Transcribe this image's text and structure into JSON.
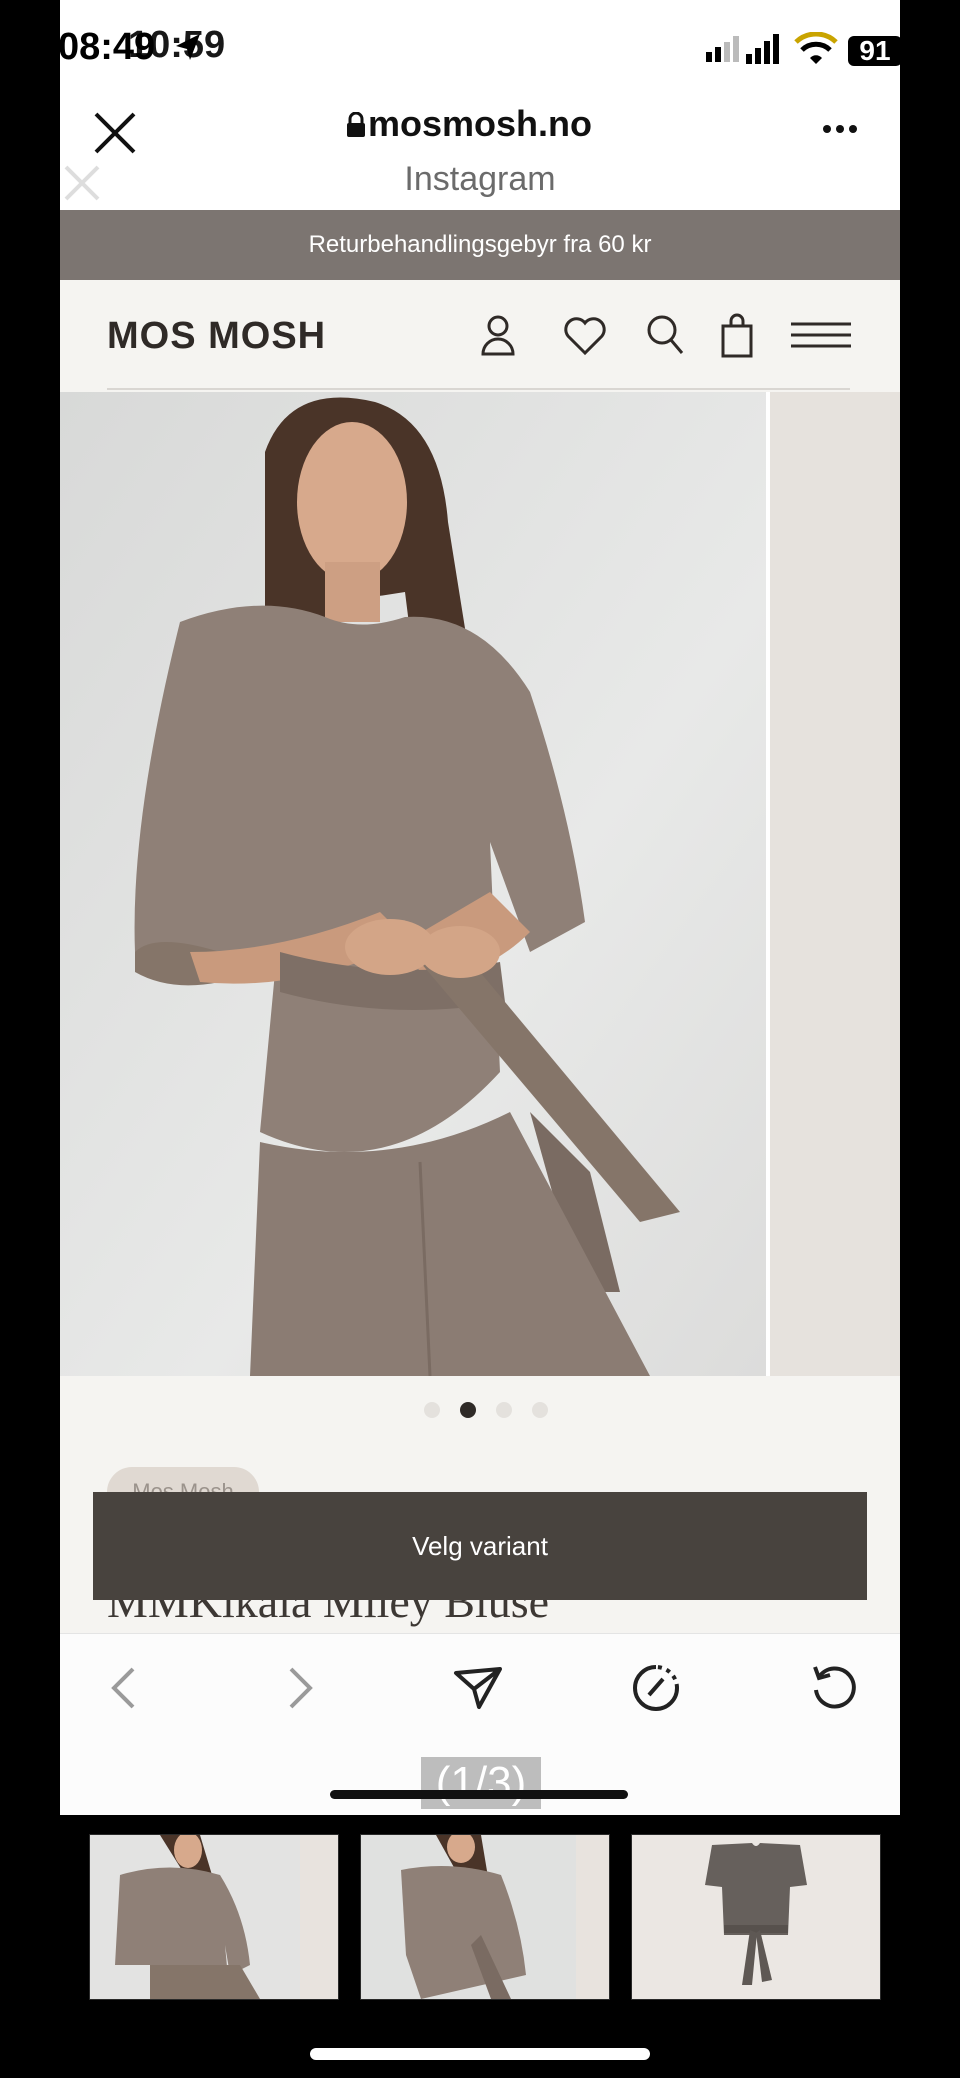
{
  "status_bar": {
    "time_main": "08:49",
    "time_overlay": "10:59",
    "battery": "91"
  },
  "browser": {
    "domain": "mosmosh.no",
    "source": "Instagram"
  },
  "announcement": "Returbehandlingsgebyr fra 60 kr",
  "site": {
    "logo": "MOS MOSH",
    "header_icons": [
      "user-icon",
      "heart-icon",
      "search-icon",
      "bag-icon",
      "menu-icon"
    ]
  },
  "gallery": {
    "dots_total": 4,
    "active_index": 1
  },
  "product": {
    "brand_chip": "Mos Mosh",
    "title": "MMKikala Miley Bluse",
    "cta": "Velg variant"
  },
  "toolbar": {
    "icons": [
      "back-arrow-icon",
      "forward-arrow-icon",
      "share-icon",
      "speed-icon",
      "reload-icon"
    ]
  },
  "viewer": {
    "counter": "(1/3)"
  },
  "colors": {
    "announce_bg": "#7c7571",
    "cta_bg": "#48433e",
    "garment": "#8f8077"
  }
}
